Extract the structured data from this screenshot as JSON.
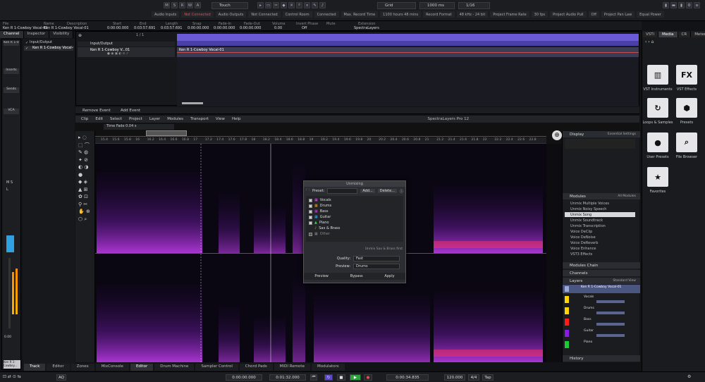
{
  "topbar": {
    "mode_buttons": [
      "M",
      "S",
      "R",
      "W",
      "A"
    ],
    "automation_mode": "Touch",
    "grid_label": "Grid",
    "quantize_value": "1/16",
    "zoom_value": "1000 ms",
    "status": [
      {
        "label": "Audio Inputs",
        "value": "Not Connected"
      },
      {
        "label": "Audio Outputs",
        "value": "Not Connected"
      },
      {
        "label": "Control Room",
        "value": "Connected"
      },
      {
        "label": "Max. Record Time",
        "value": "1100 hours 48 mins"
      },
      {
        "label": "Record Format",
        "value": "48 kHz - 24 bit"
      },
      {
        "label": "Project Frame Rate",
        "value": "30 fps"
      },
      {
        "label": "Project Audio Pull",
        "value": "Off"
      },
      {
        "label": "Project Pan Law",
        "value": "Equal Power"
      }
    ]
  },
  "infoline": {
    "columns": [
      {
        "caption": "File",
        "value": "Ken R 1-Cowboy Vocal-01"
      },
      {
        "caption": "Name",
        "value": "Ken R 1-Cowboy Vocal-01"
      },
      {
        "caption": "Description",
        "value": ""
      },
      {
        "caption": "Start",
        "value": "0:00:00.000"
      },
      {
        "caption": "End",
        "value": "0:03:57.691"
      },
      {
        "caption": "Length",
        "value": "0:03:57.691"
      },
      {
        "caption": "Snap",
        "value": "0:00:00.000"
      },
      {
        "caption": "Fade-In",
        "value": "0:00:00.000"
      },
      {
        "caption": "Fade-Out",
        "value": "0:00:00.000"
      },
      {
        "caption": "Volume",
        "value": "0.00"
      },
      {
        "caption": "Invert Phase",
        "value": "Off"
      },
      {
        "caption": "Mute",
        "value": ""
      },
      {
        "caption": "Extension",
        "value": "SpectraLayers"
      }
    ]
  },
  "left_tabs": [
    "Channel",
    "Inspector",
    "Visibility"
  ],
  "inspector": {
    "items": [
      "Input/Output",
      "Ken R 1-Cowboy Vocal-01"
    ]
  },
  "channel": {
    "slot_label": "Ken R 1-0...",
    "buttons": [
      "Inserts",
      "Sends",
      "VCA"
    ],
    "fader_value": "0.00",
    "channel_name": "Ken R 1-Cowboy..."
  },
  "arrange": {
    "track_name": "Ken R 1-Cowboy V...01",
    "folder_name": "Input/Output",
    "event_name": "Ken R 1-Cowboy Vocal-01",
    "counter": "1 / 1"
  },
  "spectralayers": {
    "top_buttons": [
      "Remove Event",
      "Add Event"
    ],
    "menu": [
      "Clip",
      "Edit",
      "Select",
      "Project",
      "Layer",
      "Modules",
      "Transport",
      "View",
      "Help"
    ],
    "app_title": "SpectraLayers Pro 12",
    "time_fade_label": "Time Fade 0.04 s",
    "time_ticks": [
      "15.4",
      "15.6",
      "15.8",
      "16",
      "16.2",
      "16.4",
      "16.6",
      "16.8",
      "17",
      "17.2",
      "17.4",
      "17.6",
      "17.8",
      "18",
      "18.2",
      "18.4",
      "18.6",
      "18.8",
      "19",
      "19.2",
      "19.4",
      "19.6",
      "19.8",
      "20",
      "20.2",
      "20.4",
      "20.6",
      "20.8",
      "21",
      "21.2",
      "21.4",
      "21.6",
      "21.8",
      "22",
      "22.2",
      "22.4",
      "22.6",
      "22.8"
    ],
    "display_panel": {
      "title": "Display",
      "preset": "Essential Settings"
    },
    "modules_panel": {
      "title": "Modules",
      "filter": "All Modules",
      "items": [
        "Unmix Multiple Voices",
        "Unmix Noisy Speech",
        "Unmix Song",
        "Unmix Soundtrack",
        "Unmix Transcription",
        "Voice DeClip",
        "Voice DeNoise",
        "Voice DeReverb",
        "Voice Enhance",
        "VST3 Effects"
      ],
      "selected": "Unmix Song"
    },
    "modules_chain": "Modules Chain",
    "channels": "Channels",
    "layers_panel": {
      "title": "Layers",
      "view": "Standard View",
      "items": [
        {
          "name": "Ken R 1-Cowboy Vocal-01",
          "color": "#9aa7d8"
        },
        {
          "name": "Vocals",
          "color": "#ffd400"
        },
        {
          "name": "Drums",
          "color": "#ffd400"
        },
        {
          "name": "Bass",
          "color": "#ff1a1a"
        },
        {
          "name": "Guitar",
          "color": "#8a1ae6"
        },
        {
          "name": "Piano",
          "color": "#1acc33"
        }
      ]
    },
    "history": "History"
  },
  "unmix_dialog": {
    "title": "Unmixing",
    "preset_label": "Preset:",
    "add_label": "Add...",
    "delete_label": "Delete...",
    "stems": [
      {
        "name": "Vocals",
        "color": "#e94bff",
        "checked": true
      },
      {
        "name": "Drums",
        "color": "#f0a020",
        "checked": true
      },
      {
        "name": "Bass",
        "color": "#d83bd8",
        "checked": true
      },
      {
        "name": "Guitar",
        "color": "#30b0ff",
        "checked": true
      },
      {
        "name": "Piano",
        "color": "#3fd050",
        "checked": true
      },
      {
        "name": "Sax & Brass",
        "color": "#f09020",
        "checked": false
      },
      {
        "name": "Other",
        "color": "#888888",
        "checked": false
      }
    ],
    "footnote": "Unmix Sax & Brass first",
    "quality_label": "Quality:",
    "quality_value": "Fast",
    "preview_label": "Preview:",
    "preview_value": "Drums",
    "buttons": [
      "Preview",
      "Bypass",
      "Apply"
    ]
  },
  "right_panel": {
    "tabs": [
      "VSTi",
      "Media",
      "CR",
      "Meter"
    ],
    "active_tab": "Media",
    "tiles": [
      {
        "label": "VST Instruments",
        "icon": "piano-icon"
      },
      {
        "label": "VST Effects",
        "icon": "fx-icon"
      },
      {
        "label": "Loops & Samples",
        "icon": "loop-icon"
      },
      {
        "label": "Presets",
        "icon": "presets-icon"
      },
      {
        "label": "User Presets",
        "icon": "user-presets-icon"
      },
      {
        "label": "File Browser",
        "icon": "file-browser-icon"
      },
      {
        "label": "Favorites",
        "icon": "star-icon"
      }
    ]
  },
  "bottom_tabs": [
    "Track",
    "Editor",
    "Zones",
    "MixConsole",
    "Editor",
    "Drum Machine",
    "Sampler Control",
    "Chord Pads",
    "MIDI Remote",
    "Modulators"
  ],
  "transport": {
    "left_time": "0:00:00.000",
    "right_time": "0:01:32.000",
    "position": "0:00:34.835",
    "tempo": "120.000",
    "signature": "4/4",
    "tap": "Tap",
    "ab": "AQ"
  },
  "colors": {
    "ruler": "#6a5ad8",
    "accent_red": "#e05050",
    "spectrum_purple": "#b040ff"
  }
}
